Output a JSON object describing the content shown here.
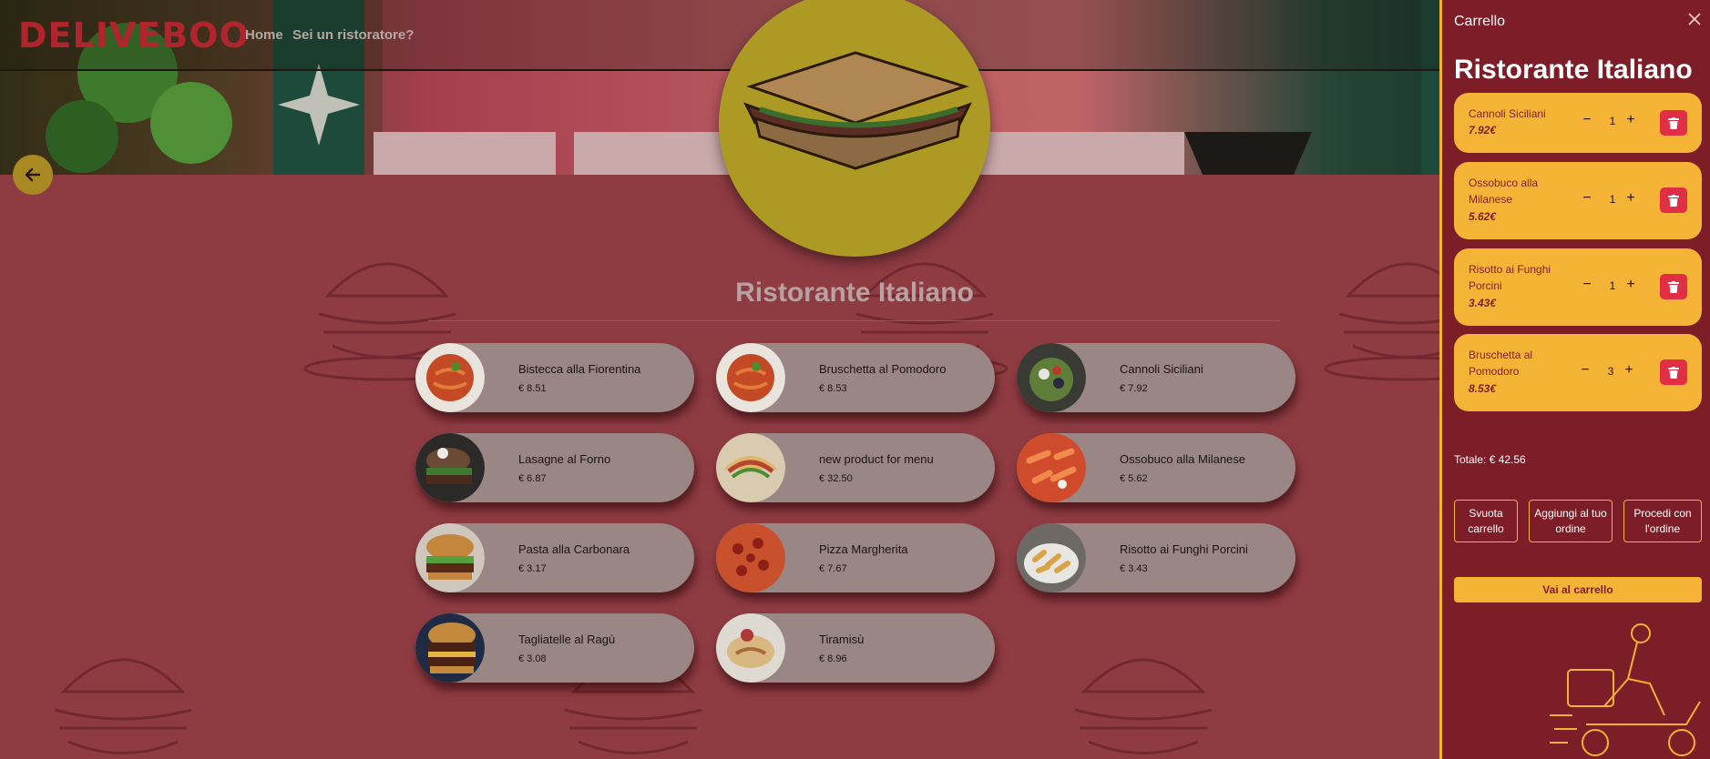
{
  "navbar": {
    "logo": "DELIVEBOO",
    "links": [
      "Home",
      "Sei un ristoratore?"
    ]
  },
  "restaurant": {
    "name": "Ristorante Italiano"
  },
  "products": [
    {
      "name": "Bistecca alla Fiorentina",
      "price": "€ 8.51",
      "image": "pasta-icon"
    },
    {
      "name": "Bruschetta al Pomodoro",
      "price": "€ 8.53",
      "image": "pasta-icon"
    },
    {
      "name": "Cannoli Siciliani",
      "price": "€ 7.92",
      "image": "salad-icon"
    },
    {
      "name": "Lasagne al Forno",
      "price": "€ 6.87",
      "image": "burger-icon"
    },
    {
      "name": "new product for menu",
      "price": "€ 32.50",
      "image": "taco-icon"
    },
    {
      "name": "Ossobuco alla Milanese",
      "price": "€ 5.62",
      "image": "penne-icon"
    },
    {
      "name": "Pasta alla Carbonara",
      "price": "€ 3.17",
      "image": "burger-icon"
    },
    {
      "name": "Pizza Margherita",
      "price": "€ 7.67",
      "image": "pizza-icon"
    },
    {
      "name": "Risotto ai Funghi Porcini",
      "price": "€ 3.43",
      "image": "fries-icon"
    },
    {
      "name": "Tagliatelle al Ragù",
      "price": "€ 3.08",
      "image": "burger-icon"
    },
    {
      "name": "Tiramisù",
      "price": "€ 8.96",
      "image": "dish-icon"
    }
  ],
  "cart": {
    "title": "Carrello",
    "close_icon": "close-icon",
    "restaurant": "Ristorante Italiano",
    "items": [
      {
        "name": "Cannoli Siciliani",
        "price": "7.92€",
        "qty": "1"
      },
      {
        "name": "Ossobuco alla Milanese",
        "price": "5.62€",
        "qty": "1"
      },
      {
        "name": "Risotto ai Funghi Porcini",
        "price": "3.43€",
        "qty": "1"
      },
      {
        "name": "Bruschetta al Pomodoro",
        "price": "8.53€",
        "qty": "3"
      }
    ],
    "total": "Totale: € 42.56",
    "buttons": {
      "empty": "Svuota carrello",
      "add": "Aggiungi al tuo ordine",
      "proceed": "Procedi con l'ordine",
      "go": "Vai al carrello"
    }
  },
  "colors": {
    "accent": "#f6b437",
    "cart_bg": "#7d1d27",
    "delete": "#e02f44",
    "logo": "#b0242e"
  }
}
